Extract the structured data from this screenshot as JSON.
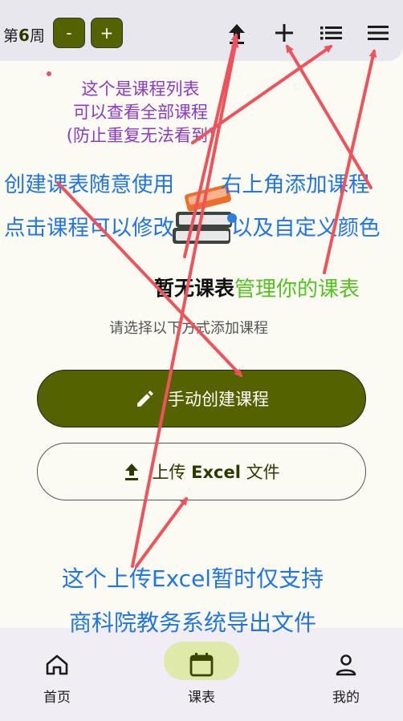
{
  "topbar": {
    "week_prefix": "第",
    "week_number": "6",
    "week_suffix": "周",
    "minus_label": "-",
    "plus_label": "+"
  },
  "annotations": {
    "course_list_line1": "这个是课程列表",
    "course_list_line2": "可以查看全部课程",
    "course_list_line3": "(防止重复无法看到)",
    "create_schedule": "创建课表随意使用",
    "add_course": "右上角添加课程",
    "edit_course": "点击课程可以修改",
    "custom_color": "以及自定义颜色",
    "manage_schedule": "管理你的课表",
    "upload_line1": "这个上传Excel暂时仅支持",
    "upload_line2": "商科院教务系统导出文件",
    "annotation_colors": {
      "purple": "#8b39c9",
      "blue": "#1f74e6",
      "green": "#53c31f",
      "arrow": "#f0525b"
    }
  },
  "empty_state": {
    "title": "暂无课表",
    "subtitle": "请选择以下方式添加课程",
    "illustration": "books-icon"
  },
  "actions": {
    "manual_create": "手动创建课程",
    "upload_prefix": "上传",
    "upload_excel": "Excel",
    "upload_suffix": "文件"
  },
  "bottom_nav": {
    "items": [
      {
        "label": "首页",
        "icon": "home-icon",
        "selected": false
      },
      {
        "label": "课表",
        "icon": "calendar-icon",
        "selected": true
      },
      {
        "label": "我的",
        "icon": "person-icon",
        "selected": false
      }
    ]
  },
  "colors": {
    "primary": "#556200",
    "nav_pill": "#dfe9a9",
    "background": "#fbfbf3",
    "topbar": "#e9e7ee"
  }
}
